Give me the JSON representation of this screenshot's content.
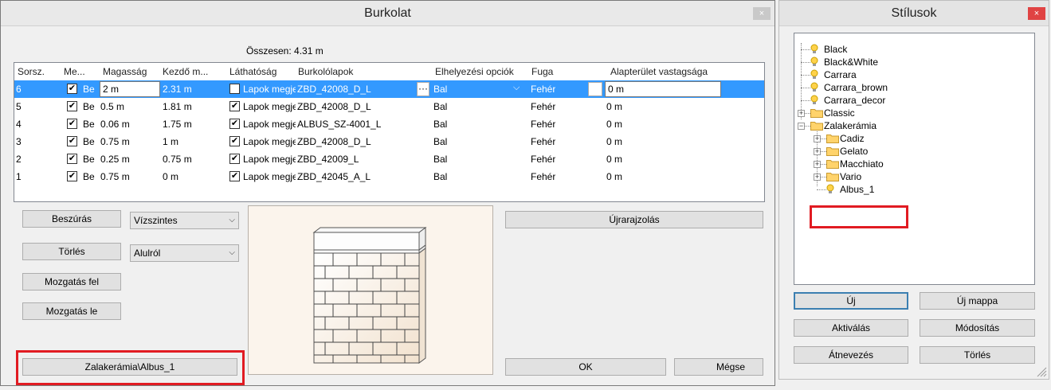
{
  "burkolat": {
    "title": "Burkolat",
    "close": "×",
    "total": "Összesen: 4.31 m",
    "columns": [
      "Sorsz.",
      "Me...",
      "Magasság",
      "Kezdő m...",
      "Láthatóság",
      "Burkolólapok",
      "Elhelyezési opciók",
      "Fuga",
      "Alapterület vastagsága"
    ],
    "rows": [
      {
        "no": "6",
        "me_checked": true,
        "me": "Be",
        "height": "2 m",
        "start": "2.31 m",
        "vis_checked": false,
        "vis": "Lapok megjel",
        "tile": "ZBD_42008_D_L",
        "placement": "Bal",
        "grout": "Fehér",
        "floor": "0 m",
        "selected": true
      },
      {
        "no": "5",
        "me_checked": true,
        "me": "Be",
        "height": "0.5 m",
        "start": "1.81 m",
        "vis_checked": true,
        "vis": "Lapok megjel",
        "tile": "ZBD_42008_D_L",
        "placement": "Bal",
        "grout": "Fehér",
        "floor": "0 m",
        "selected": false
      },
      {
        "no": "4",
        "me_checked": true,
        "me": "Be",
        "height": "0.06 m",
        "start": "1.75 m",
        "vis_checked": true,
        "vis": "Lapok megjel",
        "tile": "ALBUS_SZ-4001_L",
        "placement": "Bal",
        "grout": "Fehér",
        "floor": "0 m",
        "selected": false
      },
      {
        "no": "3",
        "me_checked": true,
        "me": "Be",
        "height": "0.75 m",
        "start": "1 m",
        "vis_checked": true,
        "vis": "Lapok megjel",
        "tile": "ZBD_42008_D_L",
        "placement": "Bal",
        "grout": "Fehér",
        "floor": "0 m",
        "selected": false
      },
      {
        "no": "2",
        "me_checked": true,
        "me": "Be",
        "height": "0.25 m",
        "start": "0.75 m",
        "vis_checked": true,
        "vis": "Lapok megjel",
        "tile": "ZBD_42009_L",
        "placement": "Bal",
        "grout": "Fehér",
        "floor": "0 m",
        "selected": false
      },
      {
        "no": "1",
        "me_checked": true,
        "me": "Be",
        "height": "0.75 m",
        "start": "0 m",
        "vis_checked": true,
        "vis": "Lapok megjel",
        "tile": "ZBD_42045_A_L",
        "placement": "Bal",
        "grout": "Fehér",
        "floor": "0 m",
        "selected": false
      }
    ],
    "ellipsis": "···",
    "buttons": {
      "insert": "Beszúrás",
      "delete": "Törlés",
      "move_up": "Mozgatás fel",
      "move_down": "Mozgatás le",
      "style": "Zalakerámia\\Albus_1",
      "redraw": "Újrarajzolás",
      "ok": "OK",
      "cancel": "Mégse"
    },
    "combos": {
      "direction": "Vízszintes",
      "origin": "Alulról"
    }
  },
  "stilusok": {
    "title": "Stílusok",
    "close": "×",
    "tree": [
      {
        "label": "Black",
        "type": "bulb"
      },
      {
        "label": "Black&White",
        "type": "bulb"
      },
      {
        "label": "Carrara",
        "type": "bulb"
      },
      {
        "label": "Carrara_brown",
        "type": "bulb"
      },
      {
        "label": "Carrara_decor",
        "type": "bulb"
      },
      {
        "label": "Classic",
        "type": "folder",
        "expander": "+"
      },
      {
        "label": "Zalakerámia",
        "type": "folder",
        "expander": "−"
      },
      {
        "label": "Cadiz",
        "type": "folder",
        "expander": "+"
      },
      {
        "label": "Gelato",
        "type": "folder",
        "expander": "+"
      },
      {
        "label": "Macchiato",
        "type": "folder",
        "expander": "+"
      },
      {
        "label": "Vario",
        "type": "folder",
        "expander": "+"
      },
      {
        "label": "Albus_1",
        "type": "bulb"
      }
    ],
    "buttons": {
      "new": "Új",
      "new_folder": "Új mappa",
      "activate": "Aktiválás",
      "modify": "Módosítás",
      "rename": "Átnevezés",
      "delete": "Törlés"
    }
  },
  "colors": {
    "selection": "#3399ff",
    "highlight": "#e11b22",
    "close": "#e04343"
  },
  "icons": {
    "bulb": "lightbulb-icon",
    "folder": "folder-icon",
    "expander": "tree-expander-icon"
  }
}
